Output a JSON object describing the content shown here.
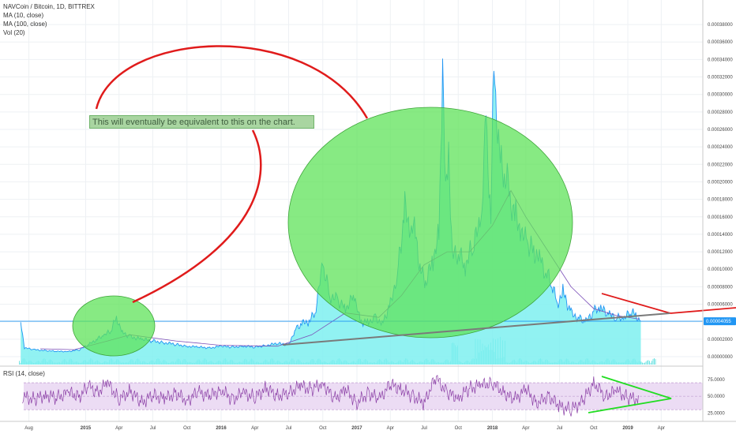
{
  "header": {
    "symbol_title": "NAVCoin / Bitcoin, 1D, BITTREX",
    "ma10_label": "MA (10, close)",
    "ma100_label": "MA (100, close)",
    "vol_label": "Vol (20)",
    "rsi_label": "RSI (14, close)"
  },
  "annotation": {
    "text": "This will eventually be equivalent to this on the chart."
  },
  "colors": {
    "price_line": "#2196f3",
    "area_fill": "#7ef0f0",
    "ma_line": "#7b4fb8",
    "volume": "#00cccc",
    "ellipse_fill": "#5fe35a",
    "ellipse_stroke": "#3ea43a",
    "red_line": "#e01b1b",
    "gray_line": "#7a7a7a",
    "rsi_line": "#8b3fa6",
    "rsi_band": "#ecdcf4",
    "green_line": "#22dd22",
    "price_badge": "#2196f3"
  },
  "chart_data": [
    {
      "type": "line",
      "title": "NAVCoin / Bitcoin, 1D, BITTREX",
      "ylim": [
        0,
        0.00039
      ],
      "y_ticks": [
        "0.00000000",
        "0.00002000",
        "0.00004000",
        "0.00006000",
        "0.00008000",
        "0.00010000",
        "0.00012000",
        "0.00014000",
        "0.00016000",
        "0.00018000",
        "0.00020000",
        "0.00022000",
        "0.00024000",
        "0.00026000",
        "0.00028000",
        "0.00030000",
        "0.00032000",
        "0.00034000",
        "0.00036000",
        "0.00038000"
      ],
      "x_ticks": [
        "Aug",
        "2015",
        "Apr",
        "Jul",
        "Oct",
        "2016",
        "Apr",
        "Jul",
        "Oct",
        "2017",
        "Apr",
        "Jul",
        "Oct",
        "2018",
        "Apr",
        "Jul",
        "Oct",
        "2019",
        "Apr"
      ],
      "current_price": "0.00004055",
      "series": [
        {
          "name": "NAVCoin / Bitcoin",
          "x": [
            "2014-07-10",
            "2014-07-20",
            "2014-08-15",
            "2014-09-15",
            "2014-10-15",
            "2014-11-15",
            "2014-12-15",
            "2015-01-10",
            "2015-02-01",
            "2015-02-20",
            "2015-03-10",
            "2015-03-25",
            "2015-04-10",
            "2015-05-01",
            "2015-06-01",
            "2015-07-01",
            "2015-08-01",
            "2015-09-01",
            "2015-10-01",
            "2015-11-01",
            "2015-12-01",
            "2016-01-01",
            "2016-02-01",
            "2016-03-01",
            "2016-04-01",
            "2016-05-01",
            "2016-06-01",
            "2016-07-01",
            "2016-07-20",
            "2016-08-05",
            "2016-08-25",
            "2016-09-10",
            "2016-10-01",
            "2016-10-20",
            "2016-11-10",
            "2016-12-01",
            "2016-12-25",
            "2017-01-10",
            "2017-02-01",
            "2017-02-20",
            "2017-03-10",
            "2017-04-01",
            "2017-04-20",
            "2017-05-10",
            "2017-05-25",
            "2017-06-05",
            "2017-06-20",
            "2017-07-05",
            "2017-07-25",
            "2017-08-10",
            "2017-08-20",
            "2017-08-28",
            "2017-09-05",
            "2017-09-15",
            "2017-10-01",
            "2017-10-20",
            "2017-11-10",
            "2017-12-01",
            "2017-12-15",
            "2017-12-28",
            "2018-01-05",
            "2018-01-15",
            "2018-01-25",
            "2018-02-05",
            "2018-02-20",
            "2018-03-05",
            "2018-03-20",
            "2018-04-05",
            "2018-04-25",
            "2018-05-10",
            "2018-05-25",
            "2018-06-10",
            "2018-06-25",
            "2018-07-10",
            "2018-08-01",
            "2018-08-20",
            "2018-09-10",
            "2018-10-01",
            "2018-10-20",
            "2018-11-10",
            "2018-12-01",
            "2018-12-20",
            "2019-01-10",
            "2019-01-25",
            "2019-02-05"
          ],
          "values": [
            4e-05,
            1e-05,
            8e-06,
            7e-06,
            6e-06,
            6e-06,
            8e-06,
            1.4e-05,
            2e-05,
            2.4e-05,
            3e-05,
            4.5e-05,
            2.8e-05,
            2.3e-05,
            2e-05,
            1.8e-05,
            1.6e-05,
            1.4e-05,
            1.2e-05,
            1.1e-05,
            1e-05,
            1.2e-05,
            1.1e-05,
            1.2e-05,
            1.1e-05,
            1.3e-05,
            1.5e-05,
            1.4e-05,
            3.2e-05,
            3.8e-05,
            4e-05,
            5e-05,
            0.000105,
            7e-05,
            6.5e-05,
            5.5e-05,
            7e-05,
            4e-05,
            4e-05,
            4.5e-05,
            3.8e-05,
            6e-05,
            9.5e-05,
            0.00017,
            0.00014,
            0.000155,
            0.0001,
            8.5e-05,
            0.00011,
            0.00014,
            0.00033,
            0.00018,
            0.00024,
            0.000115,
            0.00012,
            0.0001,
            0.00013,
            0.00015,
            0.00027,
            0.00016,
            0.00034,
            0.00025,
            0.00022,
            0.00021,
            0.00018,
            0.00016,
            0.00014,
            0.00013,
            0.00012,
            0.000115,
            9.5e-05,
            8.5e-05,
            6e-05,
            7.5e-05,
            5e-05,
            4.5e-05,
            4e-05,
            5.2e-05,
            5.5e-05,
            4.8e-05,
            4.5e-05,
            4.2e-05,
            5.2e-05,
            4.6e-05,
            4.05e-05
          ]
        },
        {
          "name": "MA (100, close)",
          "x": [
            "2014-09-01",
            "2014-12-01",
            "2015-03-01",
            "2015-05-01",
            "2015-09-01",
            "2016-01-01",
            "2016-06-01",
            "2016-09-01",
            "2016-12-01",
            "2017-03-01",
            "2017-05-01",
            "2017-07-01",
            "2017-09-01",
            "2017-11-01",
            "2018-01-01",
            "2018-02-20",
            "2018-04-01",
            "2018-06-01",
            "2018-08-01",
            "2018-10-01",
            "2018-12-01",
            "2019-02-01"
          ],
          "values": [
            9e-06,
            8e-06,
            1.8e-05,
            2.5e-05,
            1.8e-05,
            1.3e-05,
            1.2e-05,
            2.5e-05,
            5e-05,
            4.5e-05,
            7e-05,
            0.000105,
            0.00012,
            0.00012,
            0.00015,
            0.00019,
            0.00016,
            0.00012,
            8e-05,
            5.5e-05,
            4.7e-05,
            4.3e-05
          ]
        }
      ]
    },
    {
      "type": "line",
      "title": "RSI (14, close)",
      "ylim": [
        15,
        90
      ],
      "y_ticks": [
        "25.0000",
        "50.0000",
        "75.0000"
      ],
      "series": [
        {
          "name": "RSI (14, close)",
          "x": [
            "2014-07-15",
            "2014-08-15",
            "2014-09-15",
            "2014-10-15",
            "2014-11-15",
            "2014-12-15",
            "2015-01-10",
            "2015-02-01",
            "2015-03-01",
            "2015-04-01",
            "2015-05-01",
            "2015-06-01",
            "2015-07-01",
            "2015-08-01",
            "2015-09-01",
            "2015-10-01",
            "2015-11-01",
            "2015-12-01",
            "2016-01-01",
            "2016-02-01",
            "2016-03-01",
            "2016-04-01",
            "2016-05-01",
            "2016-06-01",
            "2016-07-01",
            "2016-08-01",
            "2016-09-01",
            "2016-10-01",
            "2016-11-01",
            "2016-12-01",
            "2017-01-01",
            "2017-02-01",
            "2017-03-01",
            "2017-04-01",
            "2017-05-01",
            "2017-06-01",
            "2017-07-01",
            "2017-08-01",
            "2017-09-01",
            "2017-10-01",
            "2017-11-01",
            "2017-12-01",
            "2018-01-01",
            "2018-02-01",
            "2018-03-01",
            "2018-04-01",
            "2018-05-01",
            "2018-06-01",
            "2018-07-01",
            "2018-08-01",
            "2018-09-01",
            "2018-10-01",
            "2018-11-01",
            "2018-12-01",
            "2019-01-01",
            "2019-02-01"
          ],
          "values": [
            50,
            45,
            52,
            48,
            55,
            50,
            65,
            55,
            70,
            45,
            58,
            40,
            52,
            46,
            54,
            44,
            56,
            50,
            60,
            45,
            55,
            48,
            62,
            50,
            55,
            65,
            60,
            70,
            45,
            60,
            40,
            55,
            45,
            68,
            60,
            50,
            40,
            78,
            55,
            48,
            62,
            66,
            70,
            55,
            45,
            60,
            40,
            50,
            35,
            30,
            42,
            70,
            50,
            58,
            48,
            45
          ]
        }
      ]
    }
  ]
}
